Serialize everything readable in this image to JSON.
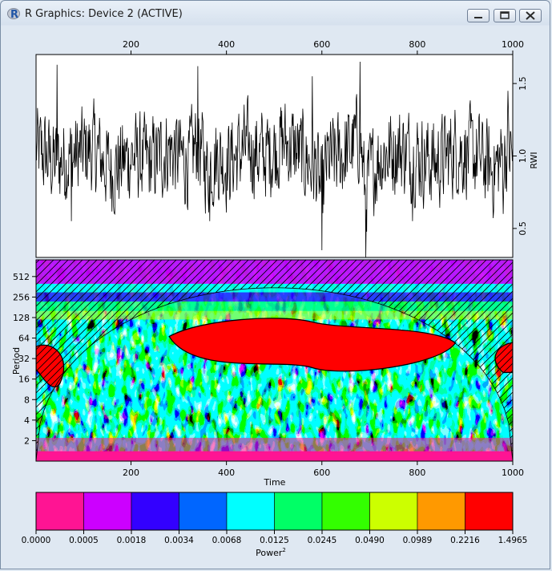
{
  "window": {
    "title": "R Graphics: Device 2 (ACTIVE)",
    "icons": {
      "app": "r-logo-icon",
      "minimize": "minimize-icon",
      "maximize": "maximize-icon",
      "close": "close-icon"
    }
  },
  "chart_data": [
    {
      "type": "line",
      "ylabel": "RWI",
      "x_range": [
        1,
        1000
      ],
      "ylim": [
        0.3,
        1.7
      ],
      "x_ticks": [
        {
          "value": 200,
          "label": "200"
        },
        {
          "value": 400,
          "label": "400"
        },
        {
          "value": 600,
          "label": "600"
        },
        {
          "value": 800,
          "label": "800"
        },
        {
          "value": 1000,
          "label": "1000"
        }
      ],
      "y_ticks": [
        {
          "value": 0.5,
          "label": "0.5"
        },
        {
          "value": 1.0,
          "label": "1.0"
        },
        {
          "value": 1.5,
          "label": "1.5"
        }
      ],
      "x_axis_position": "top",
      "y_axis_position": "right",
      "series": [
        {
          "color": "#000000",
          "x": [
            1,
            40,
            80,
            120,
            160,
            200,
            240,
            280,
            320,
            340,
            360,
            380,
            400,
            440,
            480,
            520,
            560,
            590,
            600,
            610,
            640,
            660,
            680,
            690,
            700,
            720,
            760,
            800,
            840,
            880,
            920,
            960,
            990,
            1000
          ],
          "y": [
            1.05,
            0.95,
            1.0,
            1.05,
            0.9,
            1.0,
            0.95,
            1.05,
            0.95,
            1.1,
            0.9,
            1.0,
            0.95,
            1.05,
            1.0,
            1.1,
            1.0,
            0.9,
            0.7,
            0.95,
            1.0,
            1.05,
            1.15,
            0.75,
            0.85,
            1.0,
            1.05,
            1.0,
            0.95,
            1.05,
            1.0,
            0.9,
            1.05,
            1.0
          ],
          "extremes": [
            {
              "x": 45,
              "y": 1.63
            },
            {
              "x": 75,
              "y": 0.55
            },
            {
              "x": 340,
              "y": 1.62
            },
            {
              "x": 365,
              "y": 0.55
            },
            {
              "x": 580,
              "y": 1.55
            },
            {
              "x": 600,
              "y": 0.35
            },
            {
              "x": 680,
              "y": 1.65
            },
            {
              "x": 692,
              "y": 0.3
            },
            {
              "x": 790,
              "y": 0.55
            },
            {
              "x": 990,
              "y": 1.45
            },
            {
              "x": 980,
              "y": 0.6
            }
          ]
        }
      ]
    },
    {
      "type": "heatmap",
      "xlabel": "Time",
      "ylabel": "Period",
      "x_range": [
        1,
        1000
      ],
      "y_scale": "log2",
      "ylim": [
        1,
        900
      ],
      "x_ticks": [
        {
          "value": 200,
          "label": "200"
        },
        {
          "value": 400,
          "label": "400"
        },
        {
          "value": 600,
          "label": "600"
        },
        {
          "value": 800,
          "label": "800"
        },
        {
          "value": 1000,
          "label": "1000"
        }
      ],
      "y_ticks": [
        {
          "value": 2,
          "label": "2"
        },
        {
          "value": 4,
          "label": "4"
        },
        {
          "value": 8,
          "label": "8"
        },
        {
          "value": 16,
          "label": "16"
        },
        {
          "value": 32,
          "label": "32"
        },
        {
          "value": 64,
          "label": "64"
        },
        {
          "value": 128,
          "label": "128"
        },
        {
          "value": 256,
          "label": "256"
        },
        {
          "value": 512,
          "label": "512"
        }
      ],
      "cone_of_influence": "hatched",
      "high_power_region": {
        "x_from": 280,
        "x_to": 880,
        "period_from": 20,
        "period_to": 110
      },
      "legend": {
        "label": "Power",
        "label_superscript": "2",
        "breaks": [
          "0.0000",
          "0.0005",
          "0.0018",
          "0.0034",
          "0.0068",
          "0.0125",
          "0.0245",
          "0.0490",
          "0.0989",
          "0.2216",
          "1.4965"
        ],
        "colors": [
          "#ff1493",
          "#cc00ff",
          "#3300ff",
          "#0066ff",
          "#00ffff",
          "#00ff66",
          "#33ff00",
          "#ccff00",
          "#ff9900",
          "#ff0000"
        ]
      }
    }
  ]
}
